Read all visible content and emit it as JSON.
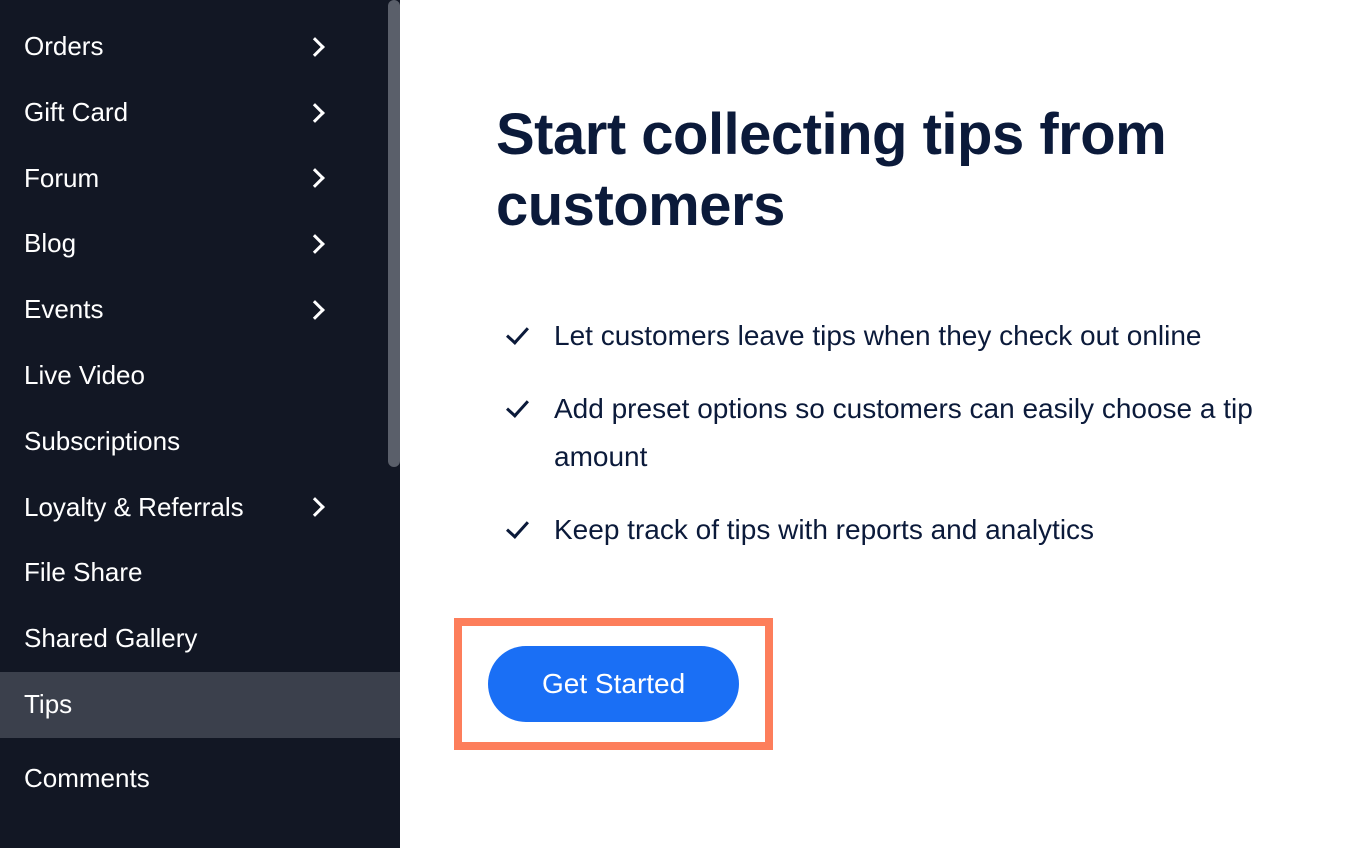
{
  "sidebar": {
    "items": [
      {
        "label": "Orders",
        "expandable": true,
        "active": false
      },
      {
        "label": "Gift Card",
        "expandable": true,
        "active": false
      },
      {
        "label": "Forum",
        "expandable": true,
        "active": false
      },
      {
        "label": "Blog",
        "expandable": true,
        "active": false
      },
      {
        "label": "Events",
        "expandable": true,
        "active": false
      },
      {
        "label": "Live Video",
        "expandable": false,
        "active": false
      },
      {
        "label": "Subscriptions",
        "expandable": false,
        "active": false
      },
      {
        "label": "Loyalty & Referrals",
        "expandable": true,
        "active": false
      },
      {
        "label": "File Share",
        "expandable": false,
        "active": false
      },
      {
        "label": "Shared Gallery",
        "expandable": false,
        "active": false
      },
      {
        "label": "Tips",
        "expandable": false,
        "active": true
      },
      {
        "label": "Comments",
        "expandable": false,
        "active": false
      }
    ]
  },
  "main": {
    "title": "Start collecting tips from customers",
    "features": [
      "Let customers leave tips when they check out online",
      "Add preset options so customers can easily choose a tip amount",
      "Keep track of tips with reports and analytics"
    ],
    "cta_label": "Get Started"
  },
  "colors": {
    "accent": "#1a6ff5",
    "highlight_border": "#fd7e5b",
    "sidebar_bg": "#121724",
    "text_dark": "#0b1a3a"
  }
}
